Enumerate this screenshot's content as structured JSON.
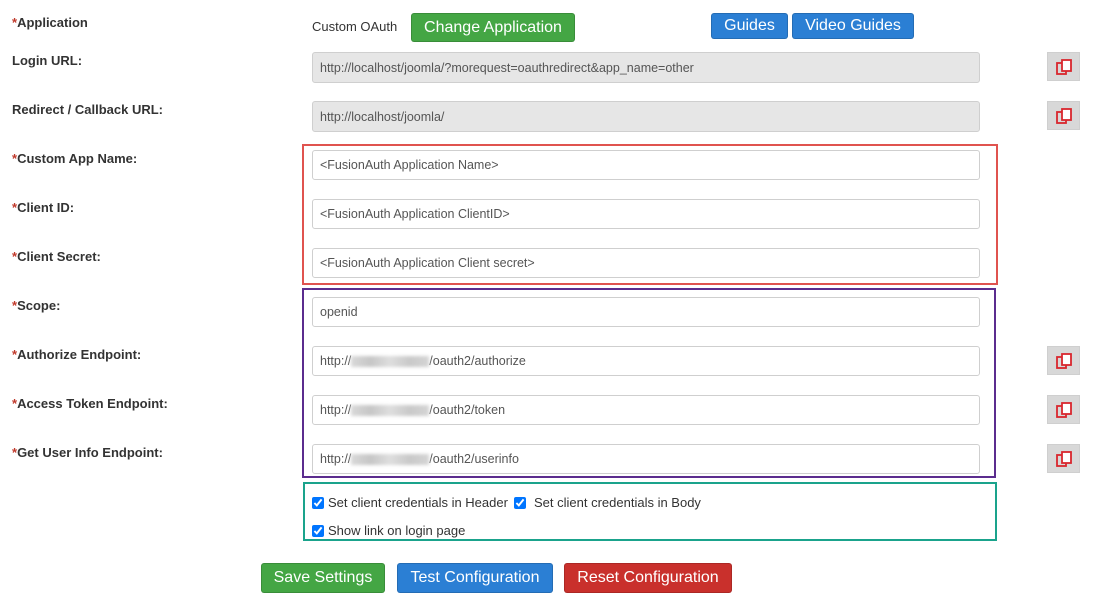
{
  "application": {
    "label": "Application",
    "value": "Custom OAuth",
    "change_button": "Change Application",
    "guides_button": "Guides",
    "video_guides_button": "Video Guides"
  },
  "login_url": {
    "label": "Login URL:",
    "value": "http://localhost/joomla/?morequest=oauthredirect&app_name=other"
  },
  "redirect_url": {
    "label": "Redirect / Callback URL:",
    "value": "http://localhost/joomla/"
  },
  "custom_app_name": {
    "label": "Custom App Name:",
    "placeholder": "<FusionAuth Application Name>"
  },
  "client_id": {
    "label": "Client ID:",
    "placeholder": "<FusionAuth Application ClientID>"
  },
  "client_secret": {
    "label": "Client Secret:",
    "placeholder": "<FusionAuth Application Client secret>"
  },
  "scope": {
    "label": "Scope:",
    "value": "openid"
  },
  "authorize_endpoint": {
    "label": "Authorize Endpoint:",
    "prefix": "http://",
    "suffix": "/oauth2/authorize"
  },
  "token_endpoint": {
    "label": "Access Token Endpoint:",
    "prefix": "http://",
    "suffix": "/oauth2/token"
  },
  "userinfo_endpoint": {
    "label": "Get User Info Endpoint:",
    "prefix": "http://",
    "suffix": "/oauth2/userinfo"
  },
  "required_marker": "*",
  "options": {
    "header_label": "Set client credentials in Header",
    "body_label": "Set client credentials in Body",
    "login_link_label": "Show link on login page"
  },
  "actions": {
    "save": "Save Settings",
    "test": "Test Configuration",
    "reset": "Reset Configuration"
  },
  "colors": {
    "green": "#44a644",
    "blue": "#2b7fd4",
    "red": "#c9302c",
    "box_red": "#e0534f",
    "box_purple": "#5b2c8e",
    "box_teal": "#1aa38c"
  },
  "icons": {
    "copy": "copy-icon"
  }
}
